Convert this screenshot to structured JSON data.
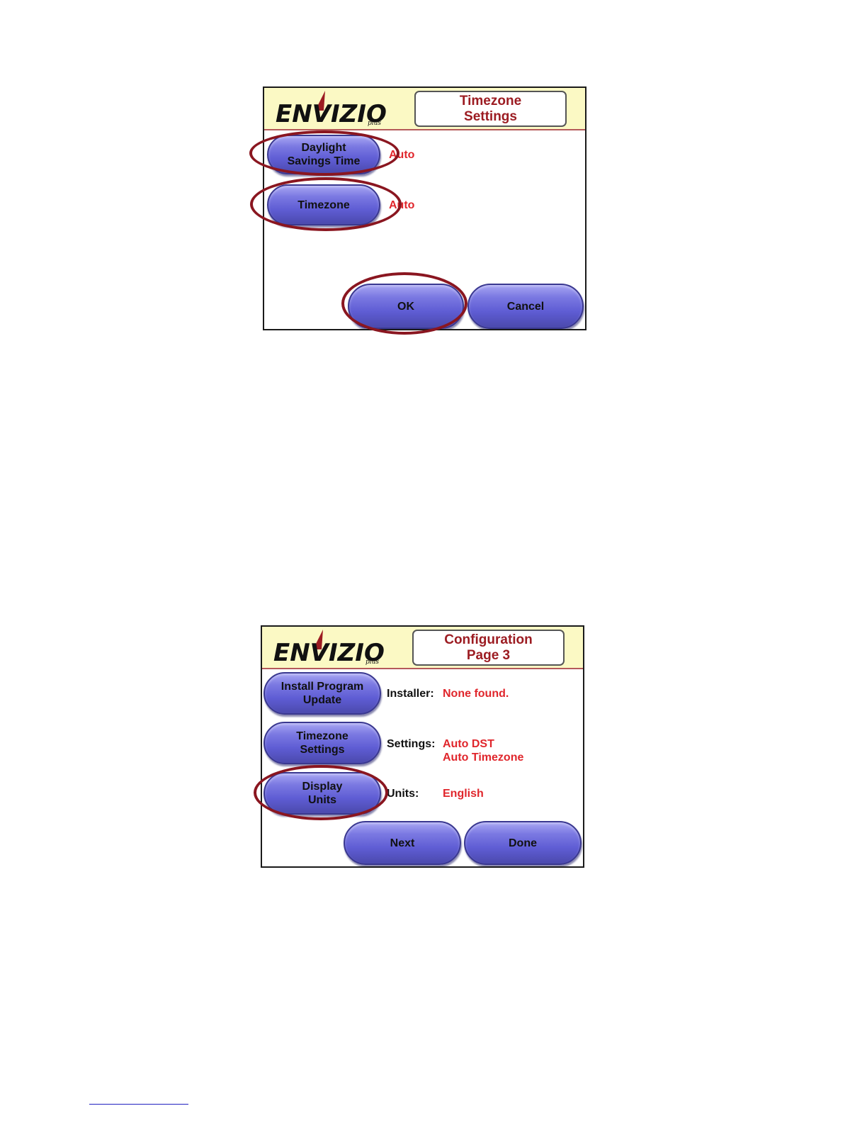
{
  "logo": {
    "alt": "Envizio plus"
  },
  "timezone_screen": {
    "title_line1": "Timezone",
    "title_line2": "Settings",
    "dst_button_line1": "Daylight",
    "dst_button_line2": "Savings Time",
    "dst_value": "Auto",
    "timezone_button": "Timezone",
    "timezone_value": "Auto",
    "ok_button": "OK",
    "cancel_button": "Cancel"
  },
  "config_screen": {
    "title_line1": "Configuration",
    "title_line2": "Page 3",
    "install_button_line1": "Install Program",
    "install_button_line2": "Update",
    "installer_label": "Installer:",
    "installer_value": "None found.",
    "tz_button_line1": "Timezone",
    "tz_button_line2": "Settings",
    "settings_label": "Settings:",
    "settings_value_line1": "Auto DST",
    "settings_value_line2": "Auto Timezone",
    "display_button_line1": "Display",
    "display_button_line2": "Units",
    "units_label": "Units:",
    "units_value": "English",
    "next_button": "Next",
    "done_button": "Done"
  },
  "colors": {
    "header_bg": "#fbf9c4",
    "button_purple": "#5f5dd4",
    "value_red": "#e0262c",
    "title_red": "#9c1c22",
    "highlight_ring": "#8a1620"
  }
}
